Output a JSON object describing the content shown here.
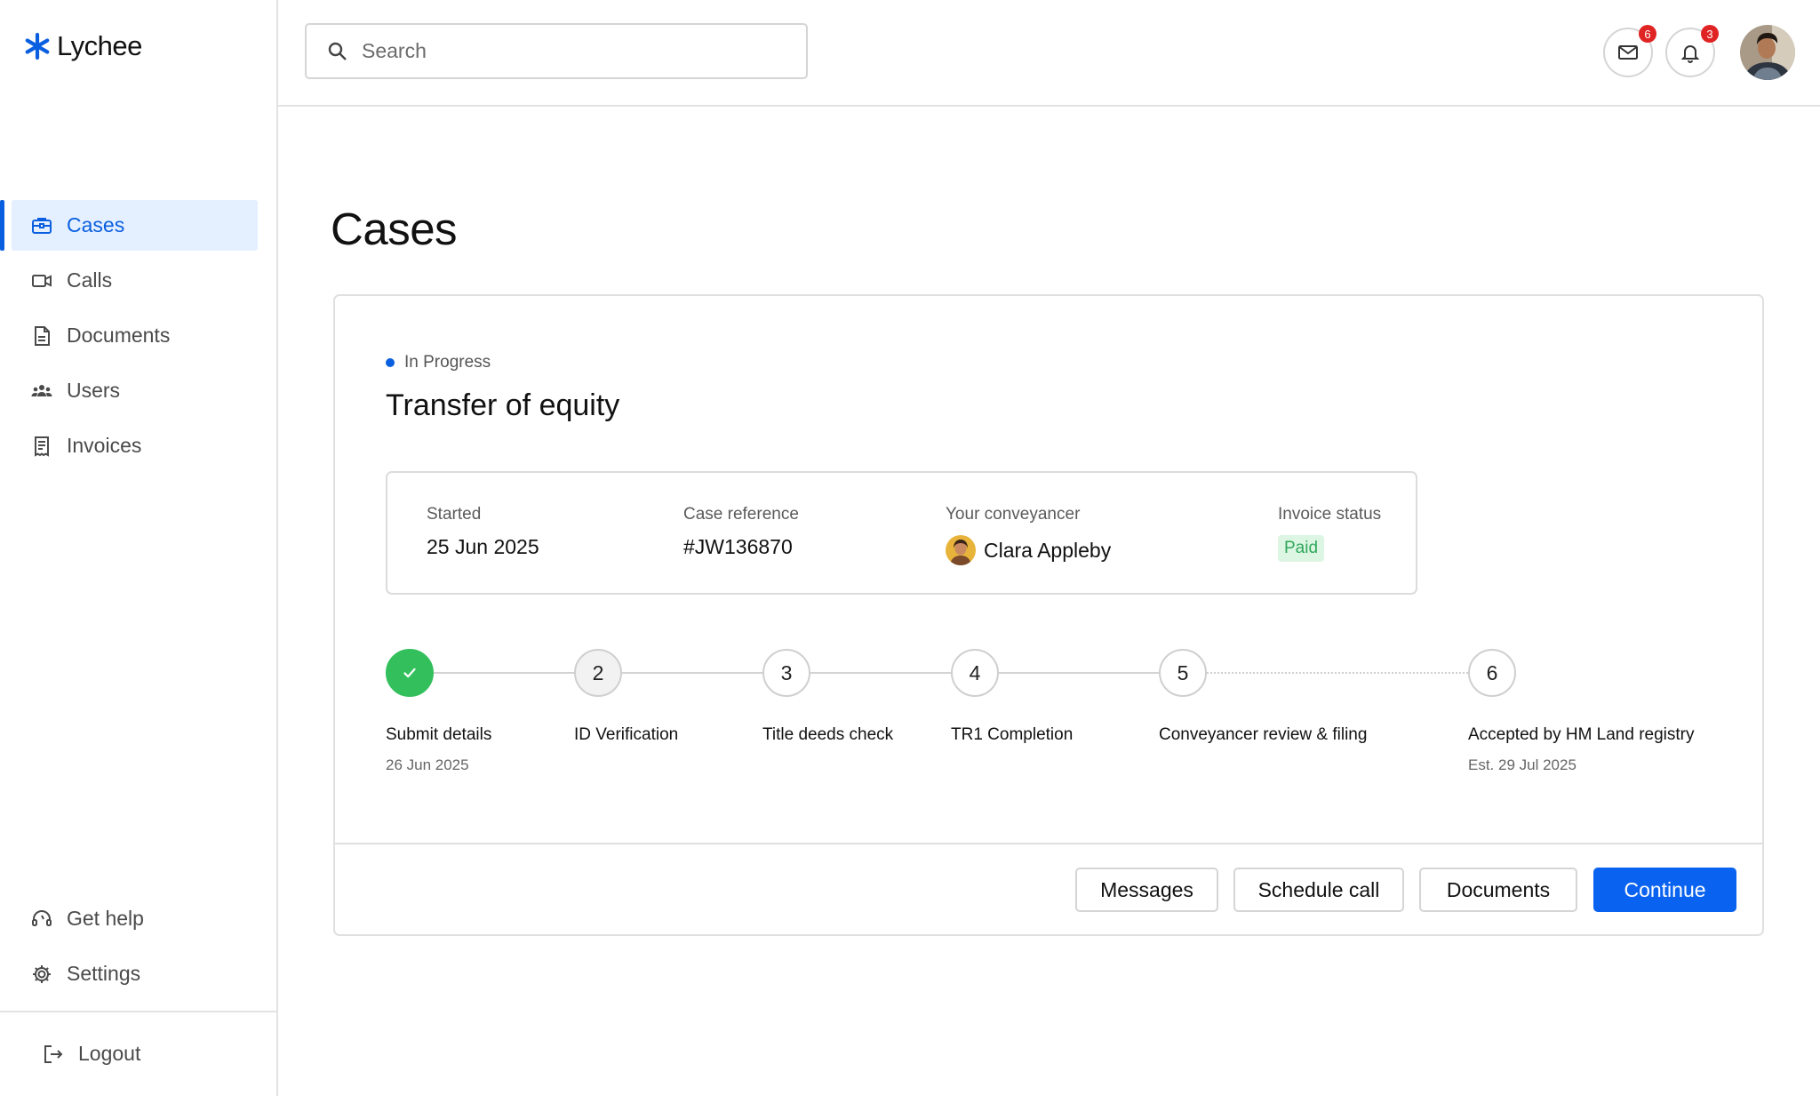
{
  "app": {
    "name": "Lychee",
    "brand_color": "#0a5fe0"
  },
  "sidebar": {
    "items": [
      {
        "label": "Cases",
        "icon": "briefcase-icon",
        "active": true
      },
      {
        "label": "Calls",
        "icon": "video-icon",
        "active": false
      },
      {
        "label": "Documents",
        "icon": "document-icon",
        "active": false
      },
      {
        "label": "Users",
        "icon": "users-icon",
        "active": false
      },
      {
        "label": "Invoices",
        "icon": "invoice-icon",
        "active": false
      }
    ],
    "bottom_items": [
      {
        "label": "Get help",
        "icon": "headset-icon"
      },
      {
        "label": "Settings",
        "icon": "gear-icon"
      }
    ],
    "logout_label": "Logout"
  },
  "header": {
    "search_placeholder": "Search",
    "mail_count": "6",
    "notification_count": "3"
  },
  "main": {
    "title": "Cases",
    "case": {
      "status": "In Progress",
      "title": "Transfer of equity",
      "info": {
        "started_label": "Started",
        "started_value": "25 Jun 2025",
        "reference_label": "Case reference",
        "reference_value": "#JW136870",
        "conveyancer_label": "Your conveyancer",
        "conveyancer_value": "Clara Appleby",
        "invoice_label": "Invoice status",
        "invoice_value": "Paid"
      },
      "steps": [
        {
          "number": "1",
          "label": "Submit details",
          "date": "26 Jun 2025",
          "state": "done"
        },
        {
          "number": "2",
          "label": "ID Verification",
          "date": "",
          "state": "current"
        },
        {
          "number": "3",
          "label": "Title deeds check",
          "date": "",
          "state": "pending"
        },
        {
          "number": "4",
          "label": "TR1 Completion",
          "date": "",
          "state": "pending"
        },
        {
          "number": "5",
          "label": "Conveyancer review & filing",
          "date": "",
          "state": "pending"
        },
        {
          "number": "6",
          "label": "Accepted by HM Land registry",
          "date": "Est. 29 Jul 2025",
          "state": "pending"
        }
      ],
      "actions": {
        "messages": "Messages",
        "schedule_call": "Schedule call",
        "documents": "Documents",
        "continue": "Continue"
      }
    }
  }
}
